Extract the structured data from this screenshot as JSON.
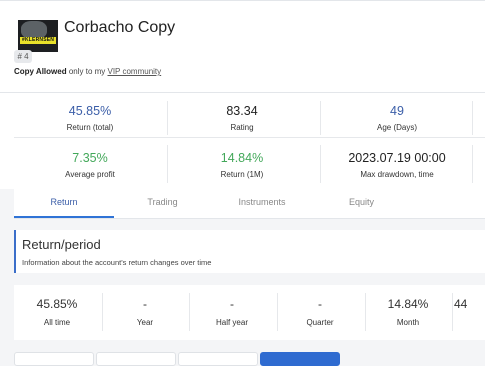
{
  "header": {
    "title": "Corbacho Copy",
    "avatar_text": "#KLERNSEN",
    "rank": "# 4",
    "copy_allowed": "Copy Allowed",
    "copy_rest": " only to my ",
    "copy_link": "VIP community"
  },
  "stats": {
    "row1": [
      {
        "value": "45.85%",
        "label": "Return (total)",
        "color": "#3b5ea8"
      },
      {
        "value": "83.34",
        "label": "Rating",
        "color": "#222222"
      },
      {
        "value": "49",
        "label": "Age (Days)",
        "color": "#3b5ea8"
      }
    ],
    "row2": [
      {
        "value": "7.35%",
        "label": "Average profit",
        "color": "#43a85a"
      },
      {
        "value": "14.84%",
        "label": "Return (1M)",
        "color": "#43a85a"
      },
      {
        "value": "2023.07.19 00:00",
        "label": "Max drawdown, time",
        "color": "#222222"
      }
    ]
  },
  "tabs": [
    {
      "label": "Return",
      "active": true
    },
    {
      "label": "Trading",
      "active": false
    },
    {
      "label": "Instruments",
      "active": false
    },
    {
      "label": "Equity",
      "active": false
    }
  ],
  "return_period": {
    "title": "Return/period",
    "description": "Information about the account's return changes over time"
  },
  "periods": [
    {
      "value": "45.85%",
      "label": "All time"
    },
    {
      "value": "-",
      "label": "Year"
    },
    {
      "value": "-",
      "label": "Half year"
    },
    {
      "value": "-",
      "label": "Quarter"
    },
    {
      "value": "14.84%",
      "label": "Month"
    },
    {
      "value": "44",
      "label": ""
    }
  ],
  "colors": {
    "accent": "#2f73d6",
    "positive": "#43a85a",
    "link_blue": "#3b5ea8"
  }
}
